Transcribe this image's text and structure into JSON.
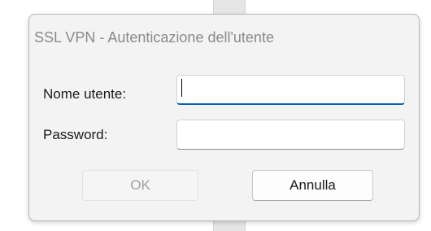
{
  "dialog": {
    "title": "SSL VPN - Autenticazione dell'utente",
    "username_label": "Nome utente:",
    "username_value": "",
    "password_label": "Password:",
    "password_value": "",
    "ok_label": "OK",
    "ok_enabled": false,
    "cancel_label": "Annulla"
  },
  "colors": {
    "focus_underline": "#0a5fb4",
    "dialog_background": "#f3f3f3",
    "disabled_text": "#a0a0a0"
  }
}
